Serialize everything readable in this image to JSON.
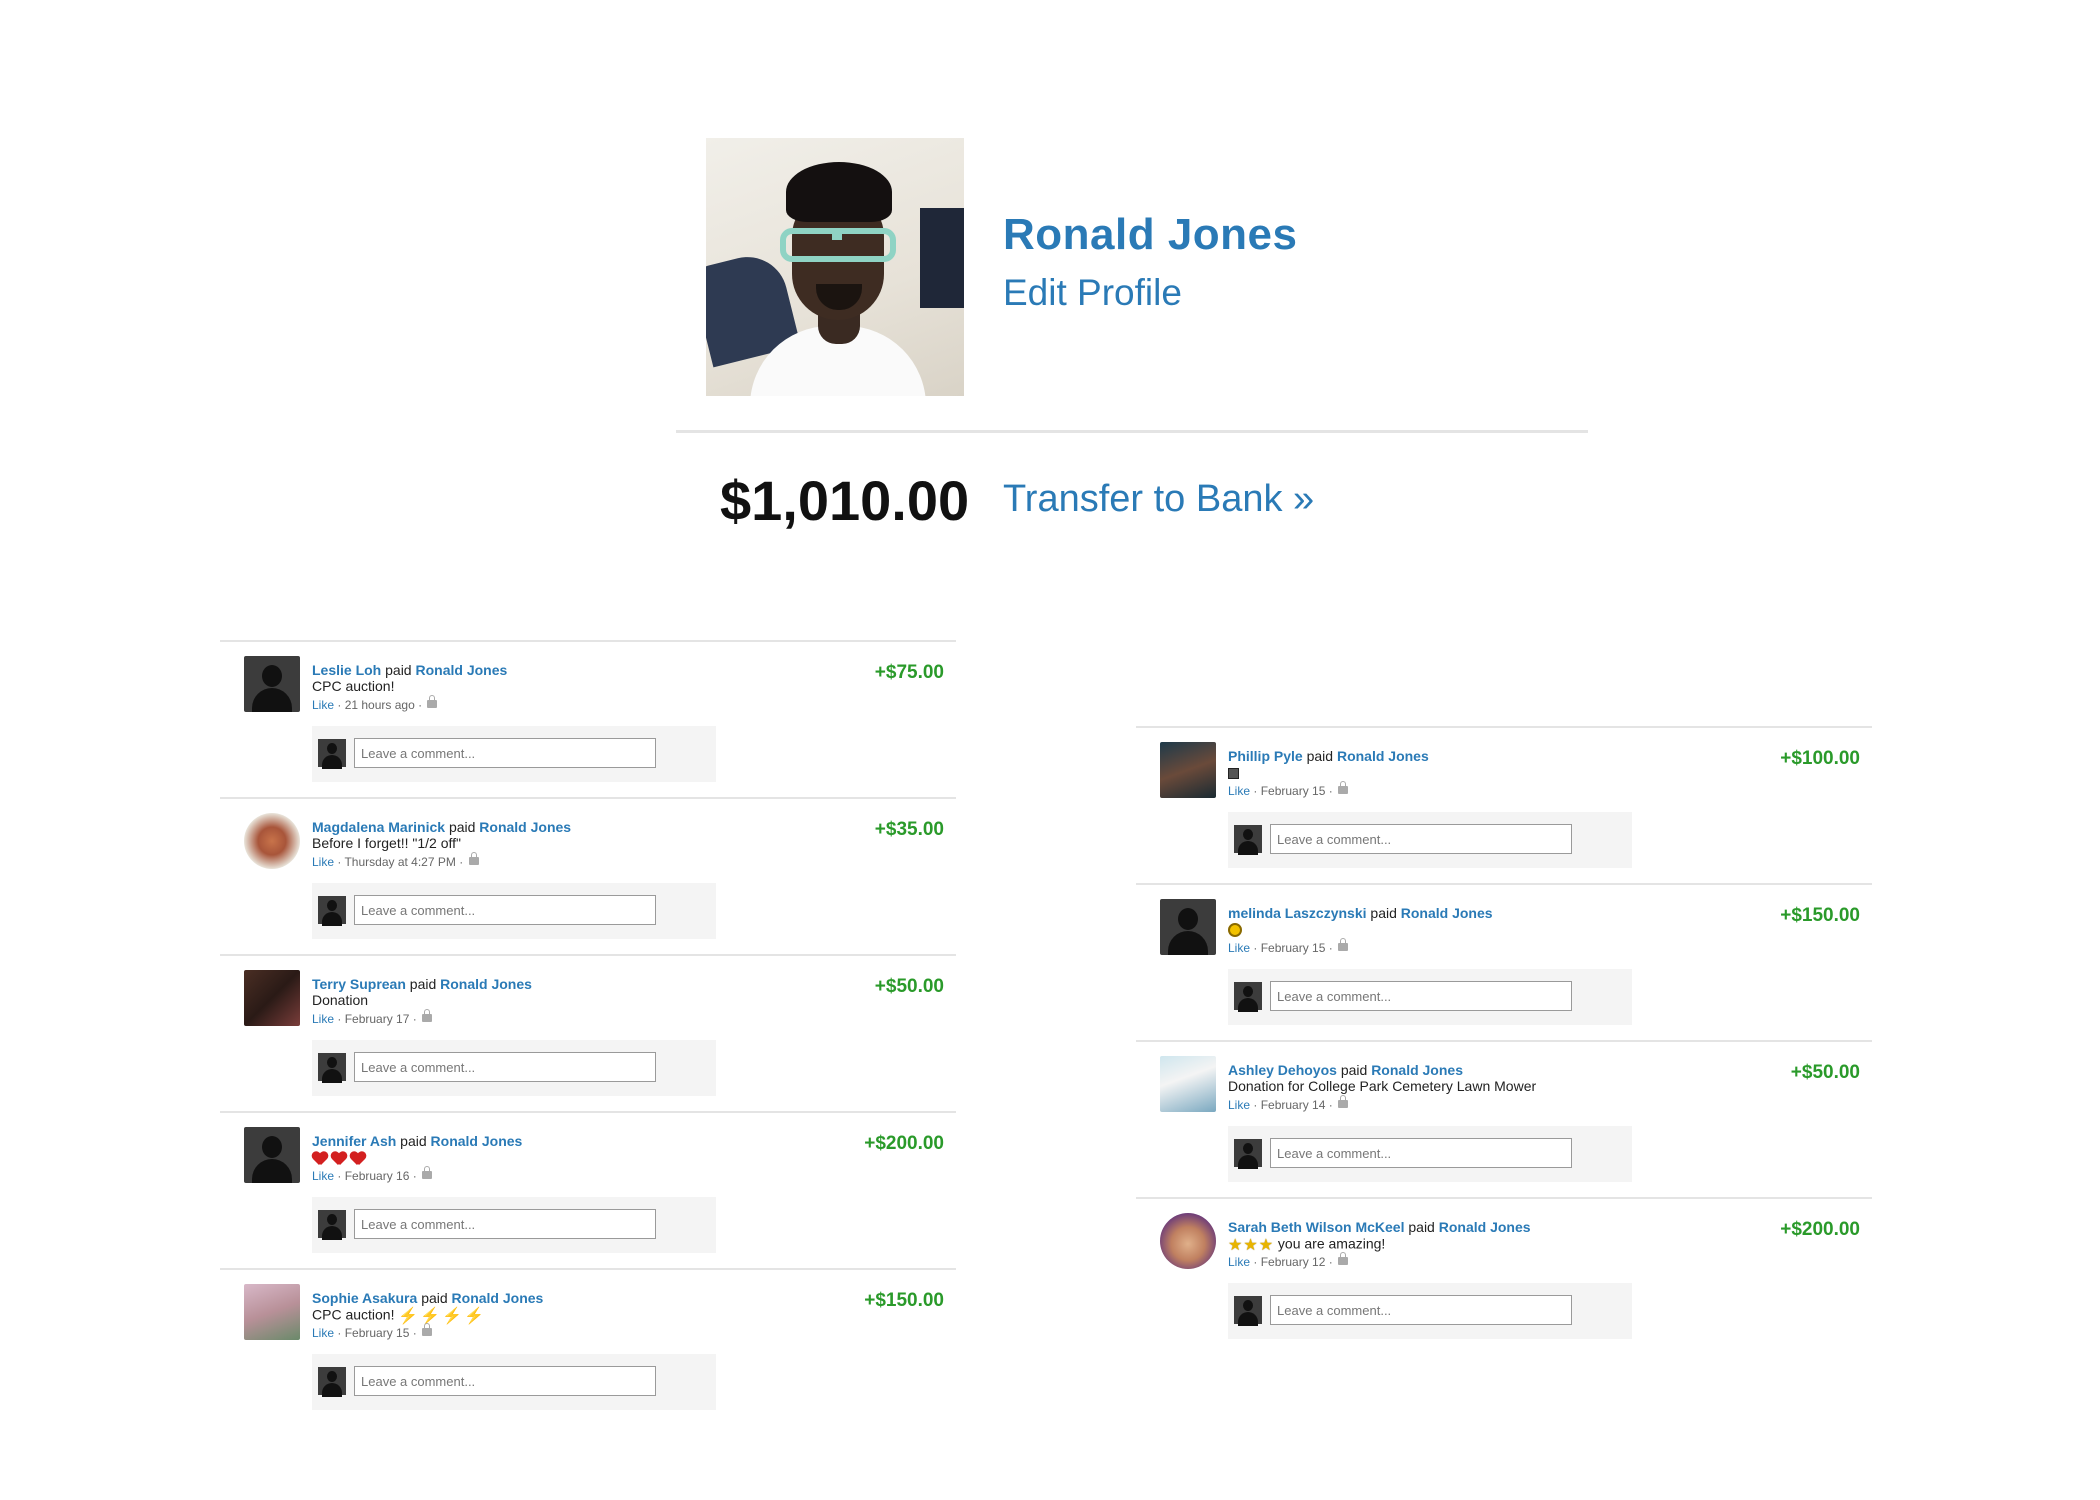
{
  "profile": {
    "name": "Ronald Jones",
    "edit_label": "Edit Profile",
    "balance": "$1,010.00",
    "transfer_label": "Transfer to Bank »"
  },
  "comment_placeholder": "Leave a comment...",
  "like_label": "Like",
  "paid_word": "paid",
  "left_feed": [
    {
      "payer": "Leslie Loh",
      "payee": "Ronald Jones",
      "note": "CPC auction!",
      "time": "21 hours ago",
      "amount": "+$75.00",
      "avatar": "silhouette"
    },
    {
      "payer": "Magdalena Marinick",
      "payee": "Ronald Jones",
      "note": "Before I forget!! \"1/2 off\"",
      "time": "Thursday at 4:27 PM",
      "amount": "+$35.00",
      "avatar": "photo"
    },
    {
      "payer": "Terry Suprean",
      "payee": "Ronald Jones",
      "note": "Donation",
      "time": "February 17",
      "amount": "+$50.00",
      "avatar": "photo"
    },
    {
      "payer": "Jennifer Ash",
      "payee": "Ronald Jones",
      "note": "",
      "note_icons": [
        "heart-icon",
        "heart-icon",
        "heart-icon"
      ],
      "time": "February 16",
      "amount": "+$200.00",
      "avatar": "silhouette"
    },
    {
      "payer": "Sophie Asakura",
      "payee": "Ronald Jones",
      "note": "CPC auction!",
      "note_icons": [
        "bolt-icon",
        "bolt-icon",
        "bolt-icon",
        "bolt-icon"
      ],
      "time": "February 15",
      "amount": "+$150.00",
      "avatar": "photo"
    }
  ],
  "right_feed": [
    {
      "payer": "Phillip Pyle",
      "payee": "Ronald Jones",
      "note": "",
      "note_icons": [
        "square-icon"
      ],
      "time": "February 15",
      "amount": "+$100.00",
      "avatar": "photo"
    },
    {
      "payer": "melinda Laszczynski",
      "payee": "Ronald Jones",
      "note": "",
      "note_icons": [
        "sun-icon"
      ],
      "time": "February 15",
      "amount": "+$150.00",
      "avatar": "silhouette"
    },
    {
      "payer": "Ashley Dehoyos",
      "payee": "Ronald Jones",
      "note": "Donation for College Park Cemetery Lawn Mower",
      "time": "February 14",
      "amount": "+$50.00",
      "avatar": "photo"
    },
    {
      "payer": "Sarah Beth Wilson McKeel",
      "payee": "Ronald Jones",
      "note": "you are amazing!",
      "note_icons": [
        "star-icon",
        "star-icon",
        "star-icon"
      ],
      "time": "February 12",
      "amount": "+$200.00",
      "avatar": "photo"
    }
  ],
  "colors": {
    "link": "#2a7ab6",
    "amount_positive": "#2a9a2a"
  }
}
